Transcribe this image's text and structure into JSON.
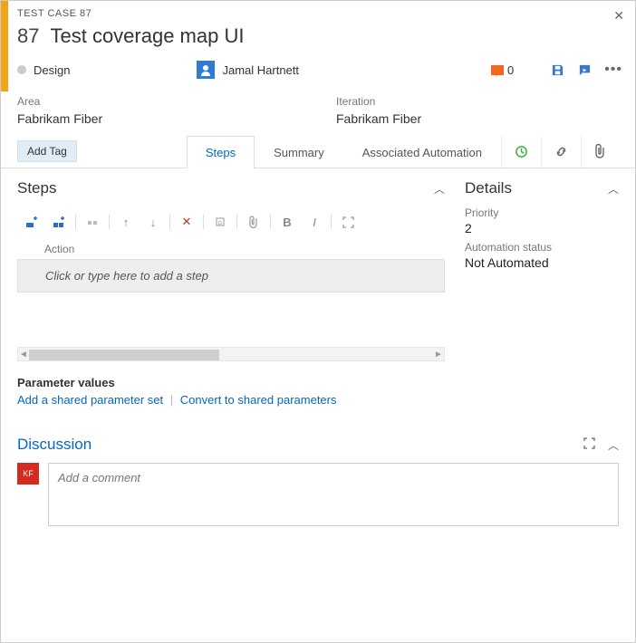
{
  "header": {
    "crumb": "TEST CASE 87",
    "id": "87",
    "title": "Test coverage map UI",
    "state": "Design",
    "assignee": "Jamal Hartnett",
    "comment_count": "0"
  },
  "fields": {
    "area_label": "Area",
    "area_value": "Fabrikam Fiber",
    "iteration_label": "Iteration",
    "iteration_value": "Fabrikam Fiber"
  },
  "tags": {
    "add_label": "Add Tag"
  },
  "tabs": {
    "steps": "Steps",
    "summary": "Summary",
    "automation": "Associated Automation"
  },
  "steps": {
    "section_title": "Steps",
    "action_header": "Action",
    "placeholder": "Click or type here to add a step"
  },
  "parameters": {
    "title": "Parameter values",
    "add_shared": "Add a shared parameter set",
    "convert": "Convert to shared parameters"
  },
  "details": {
    "section_title": "Details",
    "priority_label": "Priority",
    "priority_value": "2",
    "automation_label": "Automation status",
    "automation_value": "Not Automated"
  },
  "discussion": {
    "title": "Discussion",
    "avatar_initials": "KF",
    "placeholder": "Add a comment"
  }
}
